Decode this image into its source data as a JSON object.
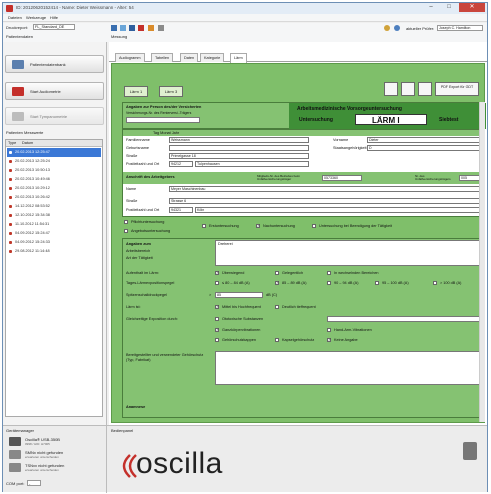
{
  "window": {
    "title": "ID: 20120620152414 - Name: Dieter Weissmann - Alter: 54"
  },
  "menu": {
    "items": [
      "Dateien",
      "Werkzeuge",
      "Hilfe"
    ]
  },
  "toolbar": {
    "druckreport_label": "Druckreport:",
    "druckreport_value": "FL_Standard_DE",
    "patientendaten_label": "Patientendaten",
    "messung_label": "Messung",
    "pruefer_label": "aktueller Prüfer:",
    "pruefer_value": "Joseph C. Hamilton"
  },
  "sidebar": {
    "buttons": [
      {
        "label": "Patientendatenbank",
        "icon": "people-icon"
      },
      {
        "label": "Start Audiometrie",
        "icon": "audiometry-icon"
      },
      {
        "label": "Start Tympanometrie",
        "icon": "tympanometry-icon"
      }
    ],
    "list_title": "Patienten Messwerte",
    "columns": [
      "Type",
      "Datum"
    ],
    "rows": [
      "20.02.2013 12:25:47",
      "20.02.2013 12:25:24",
      "20.02.2013 10:50:13",
      "20.02.2013 10:49:46",
      "20.02.2013 10:29:12",
      "20.02.2013 10:26:42",
      "14.12.2012 08:53:52",
      "12.10.2012 15:34:38",
      "11.10.2012 11:54:31",
      "04.09.2012 15:24:47",
      "04.09.2012 15:24:33",
      "29.08.2012 11:14:48"
    ],
    "selected_index": 0
  },
  "devices": {
    "title": "Gerätemanager",
    "items": [
      {
        "name": "Oscilla® USB-350B",
        "sub": "0998 / HID: H7005"
      },
      {
        "name": "SMNx nicht gefunden",
        "sub": "erwarteten unterscheiden"
      },
      {
        "name": "TSNxx nicht gefunden",
        "sub": "erwarteten unterscheiden"
      }
    ],
    "port_label": "COM port:",
    "port_value": "- "
  },
  "bedienpanel": {
    "title": "Bedienpanel",
    "logo_text": "oscilla"
  },
  "main": {
    "tabs": [
      "Audiogramm",
      "Tabellen",
      "Daten",
      "Kategorie",
      "Lärm"
    ],
    "active_tab": 4,
    "sub_buttons": [
      "Lärm 1",
      "Lärm 3"
    ],
    "pdf_button": "PDF Export für GDT",
    "form": {
      "header_left_title": "Angaben zur Person des/der Versicherten",
      "header_left_sub": "Versicherungs-Nr. des Renterversi.-Trägers",
      "header_right_title": "Arbeitsmedizinische Vorsorgeuntersuchung",
      "untersuchung_label": "Untersuchung",
      "laerm_title": "LÄRM I",
      "siebtest_label": "Siebtest",
      "tag_monat_jahr": "Tag Monat Jahr",
      "fields": [
        {
          "label": "Familienname",
          "value": "Weissmann"
        },
        {
          "label": "Geburtsname",
          "value": ""
        },
        {
          "label": "Straße",
          "value": "Primelgasse 18"
        },
        {
          "label": "Postleitzahl und Ort",
          "value": "94212",
          "value2": "Tulpenhausen"
        }
      ],
      "vorname_label": "Vorname",
      "vorname_value": "Dieter",
      "staat_label": "Staatsangehörigkeit",
      "staat_value": "D",
      "arbeitgeber_title": "Anschrift des Arbeitgebers",
      "mitglieds_label": "Mitglieds-Nr. des Betriebes beim Unfallversicherungsträger",
      "mitglieds_value": "0573360",
      "unfall_label": "Nr. des Unfallversicherungsträgers",
      "unfall_value": "005",
      "arbeitgeber_name_label": "Name",
      "arbeitgeber_name_value": "Meyer Maschinenbau",
      "arbeitgeber_street_label": "Straße",
      "arbeitgeber_street_value": "Strasse 6",
      "arbeitgeber_plz_label": "Postleitzahl und Ort",
      "arbeitgeber_plz_value": "94321",
      "arbeitgeber_ort_value": "Köln",
      "checks_row1": [
        "Pflichtuntersuchung",
        "Erstuntersuchung",
        "Nachuntersuchung",
        "Untersuchung bei Beendigung der Tätigkeit"
      ],
      "check_angebot": "Angebotsuntersuchung",
      "angaben_title": "Angaben zum",
      "angaben_sub1": "Arbeitsbereich",
      "angaben_sub2": "Art der Tätigkeit",
      "angaben_value": "Dreherei",
      "aufenthalt_label": "Aufenthalt im Lärm:",
      "aufenthalt_opts": [
        "Überwiegend",
        "Gelegentlich",
        "In wechselnden Bereichen"
      ],
      "pegel_label": "Tages-Lärmexpositionspegel",
      "pegel_opts": [
        "≤ 80 – 84 dB (A)",
        "85 – 89 dB (A)",
        "90 – 94 dB (A)",
        "95 – 100 dB (A)",
        "> 100 dB (A)"
      ],
      "spitzen_label": "Spitzenschalldruckpegel",
      "spitzen_sign": ">",
      "spitzen_value": "85",
      "spitzen_unit": "dB (C)",
      "laerm_art_label": "Lärm ist:",
      "laerm_art_opts": [
        "Mittel bis Hochfrequent",
        "Deutlich tieffrequent"
      ],
      "gleich_label": "Gleichzeitige Exposition durch:",
      "gleich_opts": [
        "Ototoxische Substanzen",
        "Ganzkörpervibrationen",
        "Hand-Arm-Vibrationen",
        "Gehörschutzkappen",
        "Kapselgehörschutz",
        "Keine Angabe"
      ],
      "gehoerschutz_label": "Bereitgestellter und verwendeter Gehörschutz (Typ, Fabrikat)",
      "anamnese_label": "Anamnese"
    }
  },
  "colors": {
    "form_green": "#7fbf6a",
    "dark_green": "#3f8f37",
    "selection": "#3b78d6",
    "brand_red": "#c4302b"
  }
}
